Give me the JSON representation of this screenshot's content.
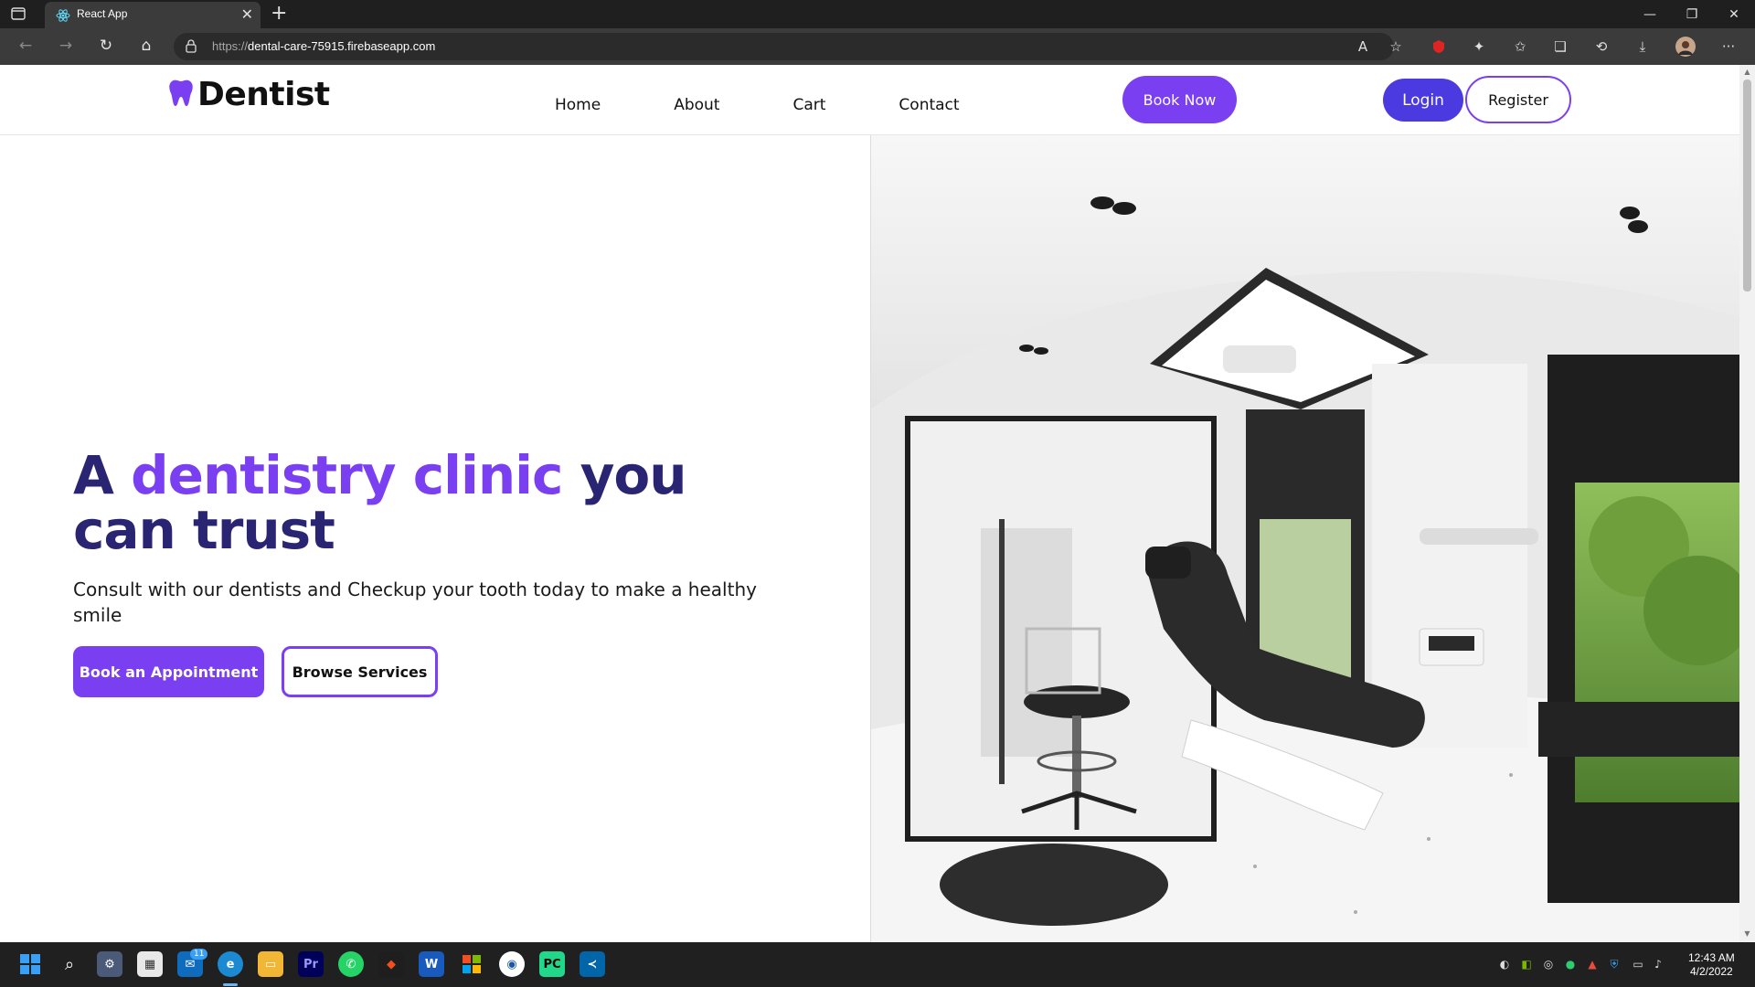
{
  "browser": {
    "tab_title": "React App",
    "url_protocol": "https://",
    "url_host": "dental-care-75915.firebaseapp.com"
  },
  "navbar": {
    "brand": "Dentist",
    "links": [
      "Home",
      "About",
      "Cart",
      "Contact"
    ],
    "book_now": "Book Now",
    "login": "Login",
    "register": "Register"
  },
  "hero": {
    "headline_part1": "A ",
    "headline_accent": "dentistry clinic",
    "headline_part2": " you can trust",
    "subtext": "Consult with our dentists and Checkup your tooth today to make a healthy smile",
    "primary_button": "Book an Appointment",
    "secondary_button": "Browse Services",
    "image_description": "dental-clinic-interior-photo"
  },
  "taskbar": {
    "time": "12:43 AM",
    "date": "4/2/2022",
    "mail_badge": "11"
  },
  "colors": {
    "accent_purple": "#7a3ff0",
    "login_blue": "#4b3ae0",
    "headline_navy": "#2a2573"
  }
}
